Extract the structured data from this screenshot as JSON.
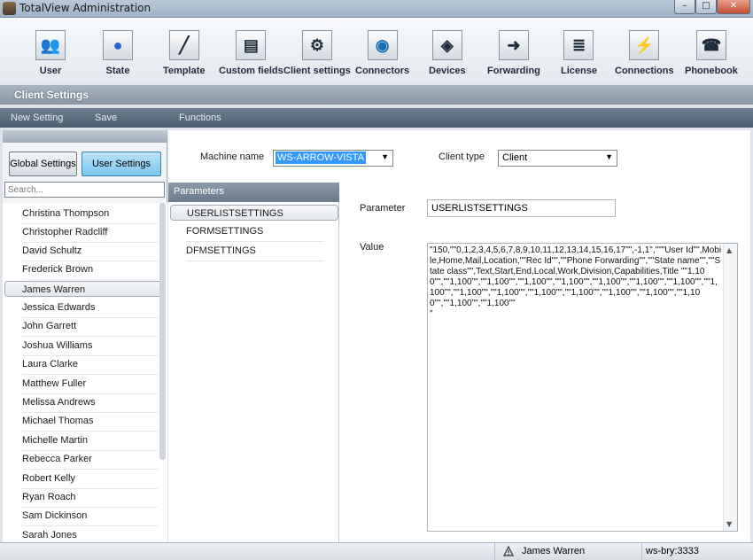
{
  "window": {
    "title": "TotalView Administration",
    "buttons": {
      "minimize": "–",
      "maximize": "□",
      "close": "✕"
    }
  },
  "toolbar": {
    "items": [
      {
        "label": "User",
        "icon": "user-icon",
        "glyph": "👥"
      },
      {
        "label": "State",
        "icon": "state-icon",
        "glyph": "●"
      },
      {
        "label": "Template",
        "icon": "template-icon",
        "glyph": "╱"
      },
      {
        "label": "Custom fields",
        "icon": "custom-fields-icon",
        "glyph": "▤"
      },
      {
        "label": "Client settings",
        "icon": "client-settings-icon",
        "glyph": "⚙"
      },
      {
        "label": "Connectors",
        "icon": "connectors-icon",
        "glyph": "◉"
      },
      {
        "label": "Devices",
        "icon": "devices-icon",
        "glyph": "◈"
      },
      {
        "label": "Forwarding",
        "icon": "forwarding-icon",
        "glyph": "➜"
      },
      {
        "label": "License",
        "icon": "license-icon",
        "glyph": "≣"
      },
      {
        "label": "Connections",
        "icon": "connections-icon",
        "glyph": "⚡"
      },
      {
        "label": "Phonebook",
        "icon": "phonebook-icon",
        "glyph": "☎"
      }
    ],
    "section_title": "Client Settings"
  },
  "menu": {
    "new_setting": "New Setting",
    "save": "Save",
    "functions": "Functions"
  },
  "left": {
    "global_button": "Global Settings",
    "user_button": "User Settings",
    "search_placeholder": "Search...",
    "users": [
      "Christina Thompson",
      "Christopher Radcliff",
      "David Schultz",
      "Frederick Brown",
      "James Warren",
      "Jessica Edwards",
      "John Garrett",
      "Joshua Williams",
      "Laura Clarke",
      "Matthew Fuller",
      "Melissa Andrews",
      "Michael Thomas",
      "Michelle Martin",
      "Rebecca Parker",
      "Robert Kelly",
      "Ryan Roach",
      "Sam Dickinson",
      "Sarah Jones"
    ],
    "selected_user": "James Warren"
  },
  "main": {
    "machine_name_label": "Machine name",
    "machine_name_value": "WS-ARROW-VISTA",
    "client_type_label": "Client type",
    "client_type_value": "Client",
    "parameters_header": "Parameters",
    "parameters": [
      "USERLISTSETTINGS",
      "FORMSETTINGS",
      "DFMSETTINGS"
    ],
    "selected_parameter": "USERLISTSETTINGS",
    "parameter_label": "Parameter",
    "parameter_value": "USERLISTSETTINGS",
    "value_label": "Value",
    "value_text": "\"150,\"\"0,1,2,3,4,5,6,7,8,9,10,11,12,13,14,15,16,17\"\",-1,1\",\"\"\"User Id\"\",Mobile,Home,Mail,Location,\"\"Rec Id\"\",\"\"Phone Forwarding\"\",\"\"State name\"\",\"\"State class\"\",Text,Start,End,Local,Work,Division,Capabilities,Title \"\"1,100\"\",\"\"1,100\"\",\"\"1,100\"\",\"\"1,100\"\",\"\"1,100\"\",\"\"1,100\"\",\"\"1,100\"\",\"\"1,100\"\",\"\"1,100\"\",\"\"1,100\"\",\"\"1,100\"\",\"\"1,100\"\",\"\"1,100\"\",\"\"1,100\"\",\"\"1,100\"\",\"\"1,100\"\",\"\"1,100\"\",\"\"1,100\"\"\n\""
  },
  "status": {
    "user": "James Warren",
    "host": "ws-bry:3333"
  },
  "colors": {
    "accent_blue": "#3399ff",
    "menu_strip": "#5a6b7d",
    "user_button": "#7cc6ef"
  }
}
